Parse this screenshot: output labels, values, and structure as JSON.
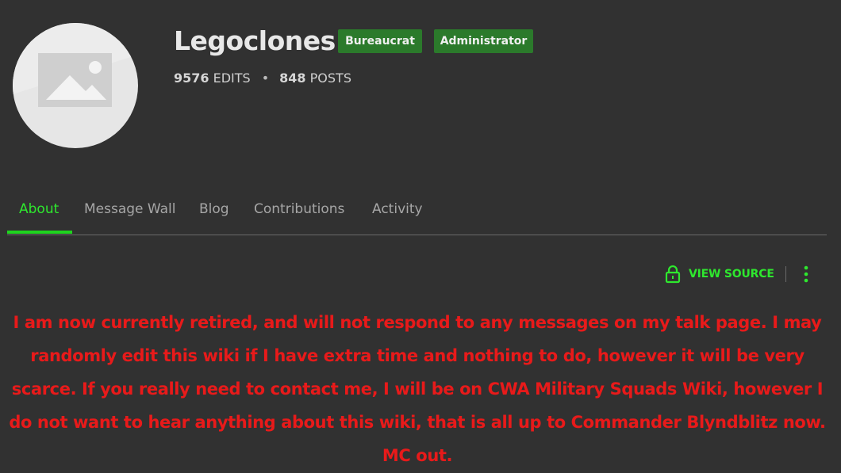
{
  "profile": {
    "username": "Legoclones",
    "badges": [
      "Bureaucrat",
      "Administrator"
    ],
    "edits_count": "9576",
    "edits_label": "EDITS",
    "posts_count": "848",
    "posts_label": "POSTS",
    "separator": "•"
  },
  "tabs": [
    {
      "label": "About",
      "active": true
    },
    {
      "label": "Message Wall",
      "active": false
    },
    {
      "label": "Blog",
      "active": false
    },
    {
      "label": "Contributions",
      "active": false
    },
    {
      "label": "Activity",
      "active": false
    }
  ],
  "toolbar": {
    "view_source_label": "VIEW SOURCE",
    "view_source_icon": "lock-icon",
    "more_icon": "kebab-menu-icon"
  },
  "bio": {
    "text": "I am now currently retired, and will not respond to any messages on my talk page. I may randomly edit this wiki if I have extra time and nothing to do, however it will be very scarce. If you really need to contact me, I will be on CWA Military Squads Wiki, however I do not want to hear anything about this wiki, that is all up to Commander Blyndblitz now. MC out."
  },
  "colors": {
    "background": "#313131",
    "accent": "#2ee82e",
    "badge": "#2b7a2b",
    "bio_text": "#e81a1a"
  }
}
